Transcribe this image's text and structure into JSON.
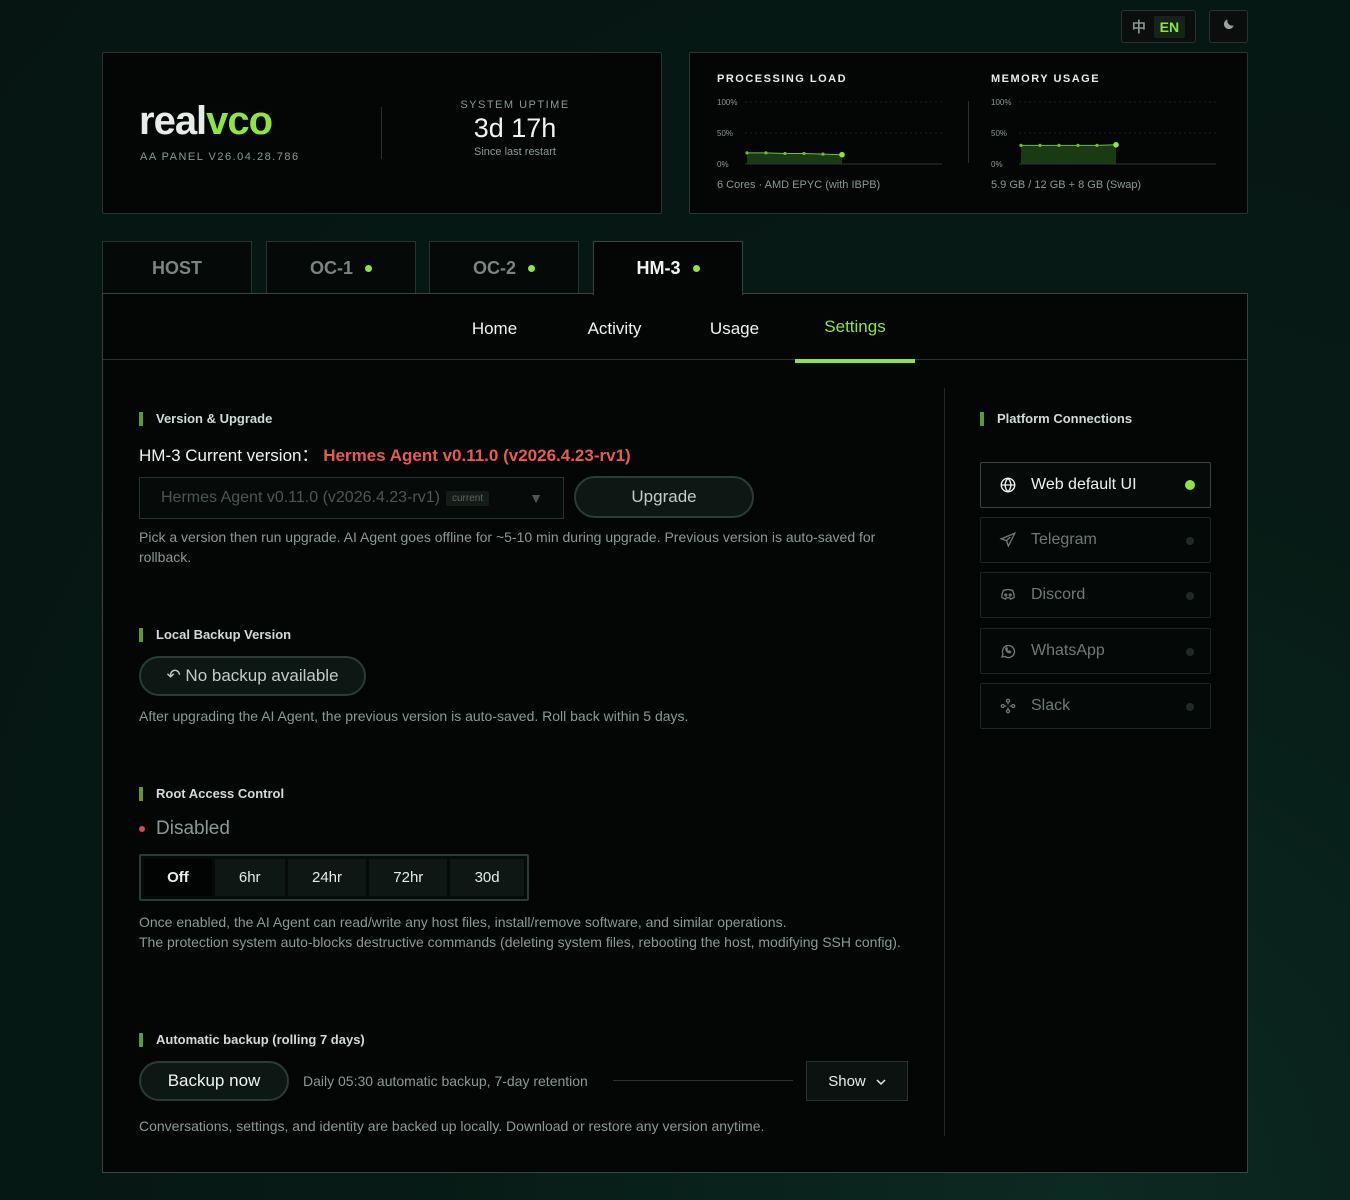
{
  "lang": {
    "zh": "中",
    "en": "EN"
  },
  "icons": {
    "theme": "moon-icon"
  },
  "brand": {
    "logo_white": "real",
    "logo_green": "vco",
    "panel_version": "AA PANEL V26.04.28.786"
  },
  "uptime": {
    "label": "SYSTEM UPTIME",
    "value": "3d 17h",
    "sub": "Since last restart"
  },
  "processing": {
    "title": "PROCESSING LOAD",
    "footer": "6 Cores · AMD EPYC (with IBPB)",
    "chart_data": {
      "type": "line",
      "y_ticks": [
        "100%",
        "50%",
        "0%"
      ],
      "ylim": [
        0,
        100
      ],
      "values": [
        18,
        18,
        17,
        17,
        16,
        15
      ]
    }
  },
  "memory": {
    "title": "MEMORY USAGE",
    "footer": "5.9 GB / 12 GB + 8 GB (Swap)",
    "chart_data": {
      "type": "line",
      "y_ticks": [
        "100%",
        "50%",
        "0%"
      ],
      "ylim": [
        0,
        100
      ],
      "values": [
        30,
        30,
        30,
        30,
        30,
        31
      ]
    }
  },
  "tabs": [
    {
      "label": "HOST",
      "dot": false
    },
    {
      "label": "OC-1",
      "dot": true
    },
    {
      "label": "OC-2",
      "dot": true
    },
    {
      "label": "HM-3",
      "dot": true
    }
  ],
  "subtabs": [
    "Home",
    "Activity",
    "Usage",
    "Settings"
  ],
  "version": {
    "heading": "Version & Upgrade",
    "current_prefix": "HM-3 Current version：",
    "current_value": "Hermes Agent v0.11.0 (v2026.4.23-rv1)",
    "select_value": "Hermes Agent v0.11.0 (v2026.4.23-rv1)",
    "select_tag": "current",
    "upgrade_label": "Upgrade",
    "help": "Pick a version then run upgrade. AI Agent goes offline for ~5-10 min during upgrade. Previous version is auto-saved for rollback."
  },
  "backup_local": {
    "heading": "Local Backup Version",
    "button": "↶ No backup available",
    "help": "After upgrading the AI Agent, the previous version is auto-saved. Roll back within 5 days."
  },
  "root": {
    "heading": "Root Access Control",
    "status": "Disabled",
    "options": [
      "Off",
      "6hr",
      "24hr",
      "72hr",
      "30d"
    ],
    "help_1": "Once enabled, the AI Agent can read/write any host files, install/remove software, and similar operations.",
    "help_2": "The protection system auto-blocks destructive commands (deleting system files, rebooting the host, modifying SSH config)."
  },
  "auto_backup": {
    "heading": "Automatic backup (rolling 7 days)",
    "button": "Backup now",
    "schedule": "Daily 05:30 automatic backup, 7-day retention",
    "show_label": "Show",
    "help": "Conversations, settings, and identity are backed up locally. Download or restore any version anytime."
  },
  "platforms": {
    "heading": "Platform Connections",
    "items": [
      {
        "label": "Web default UI",
        "icon": "globe-icon",
        "active": true
      },
      {
        "label": "Telegram",
        "icon": "send-icon",
        "active": false
      },
      {
        "label": "Discord",
        "icon": "discord-icon",
        "active": false
      },
      {
        "label": "WhatsApp",
        "icon": "whatsapp-icon",
        "active": false
      },
      {
        "label": "Slack",
        "icon": "slack-icon",
        "active": false
      }
    ]
  },
  "colors": {
    "accent": "#8ee53f",
    "danger": "#e85a4f",
    "background": "#061512"
  }
}
